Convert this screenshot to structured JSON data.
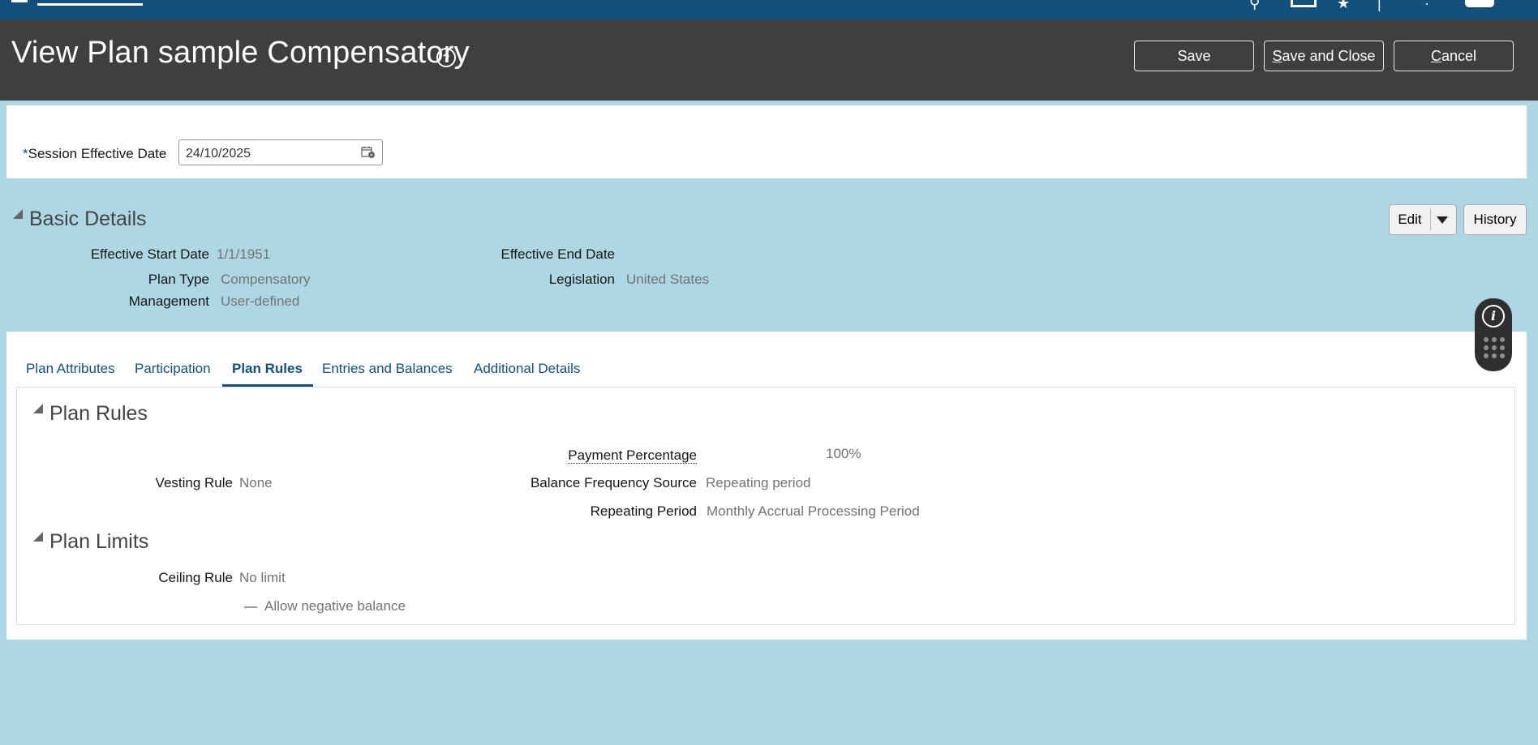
{
  "page": {
    "title": "View Plan sample Compensatory",
    "buttons": {
      "save": "Save",
      "save_and_close_mnemonic": "S",
      "save_and_close_rest": "ave and Close",
      "cancel_mnemonic": "C",
      "cancel_rest": "ancel"
    }
  },
  "session": {
    "required_marker": "*",
    "label": "Session Effective Date",
    "date_value": "24/10/2025"
  },
  "basic_details": {
    "heading": "Basic Details",
    "edit_label": "Edit",
    "history_label": "History",
    "fields": {
      "effective_start_date_label": "Effective Start Date",
      "effective_start_date_value": "1/1/1951",
      "effective_end_date_label": "Effective End Date",
      "plan_type_label": "Plan Type",
      "plan_type_value": "Compensatory",
      "legislation_label": "Legislation",
      "legislation_value": "United States",
      "management_label": "Management",
      "management_value": "User-defined"
    }
  },
  "tabs": [
    {
      "label": "Plan Attributes"
    },
    {
      "label": "Participation"
    },
    {
      "label": "Plan Rules"
    },
    {
      "label": "Entries and Balances"
    },
    {
      "label": "Additional Details"
    }
  ],
  "active_tab": "Plan Rules",
  "plan_rules": {
    "heading": "Plan Rules",
    "payment_percentage_label": "Payment Percentage",
    "payment_percentage_value": "100%",
    "vesting_rule_label": "Vesting Rule",
    "vesting_rule_value": "None",
    "balance_frequency_source_label": "Balance Frequency Source",
    "balance_frequency_source_value": "Repeating period",
    "repeating_period_label": "Repeating Period",
    "repeating_period_value": "Monthly Accrual Processing Period"
  },
  "plan_limits": {
    "heading": "Plan Limits",
    "ceiling_rule_label": "Ceiling Rule",
    "ceiling_rule_value": "No limit",
    "allow_negative_balance_label": "Allow negative balance",
    "allow_negative_balance_checked": false
  }
}
